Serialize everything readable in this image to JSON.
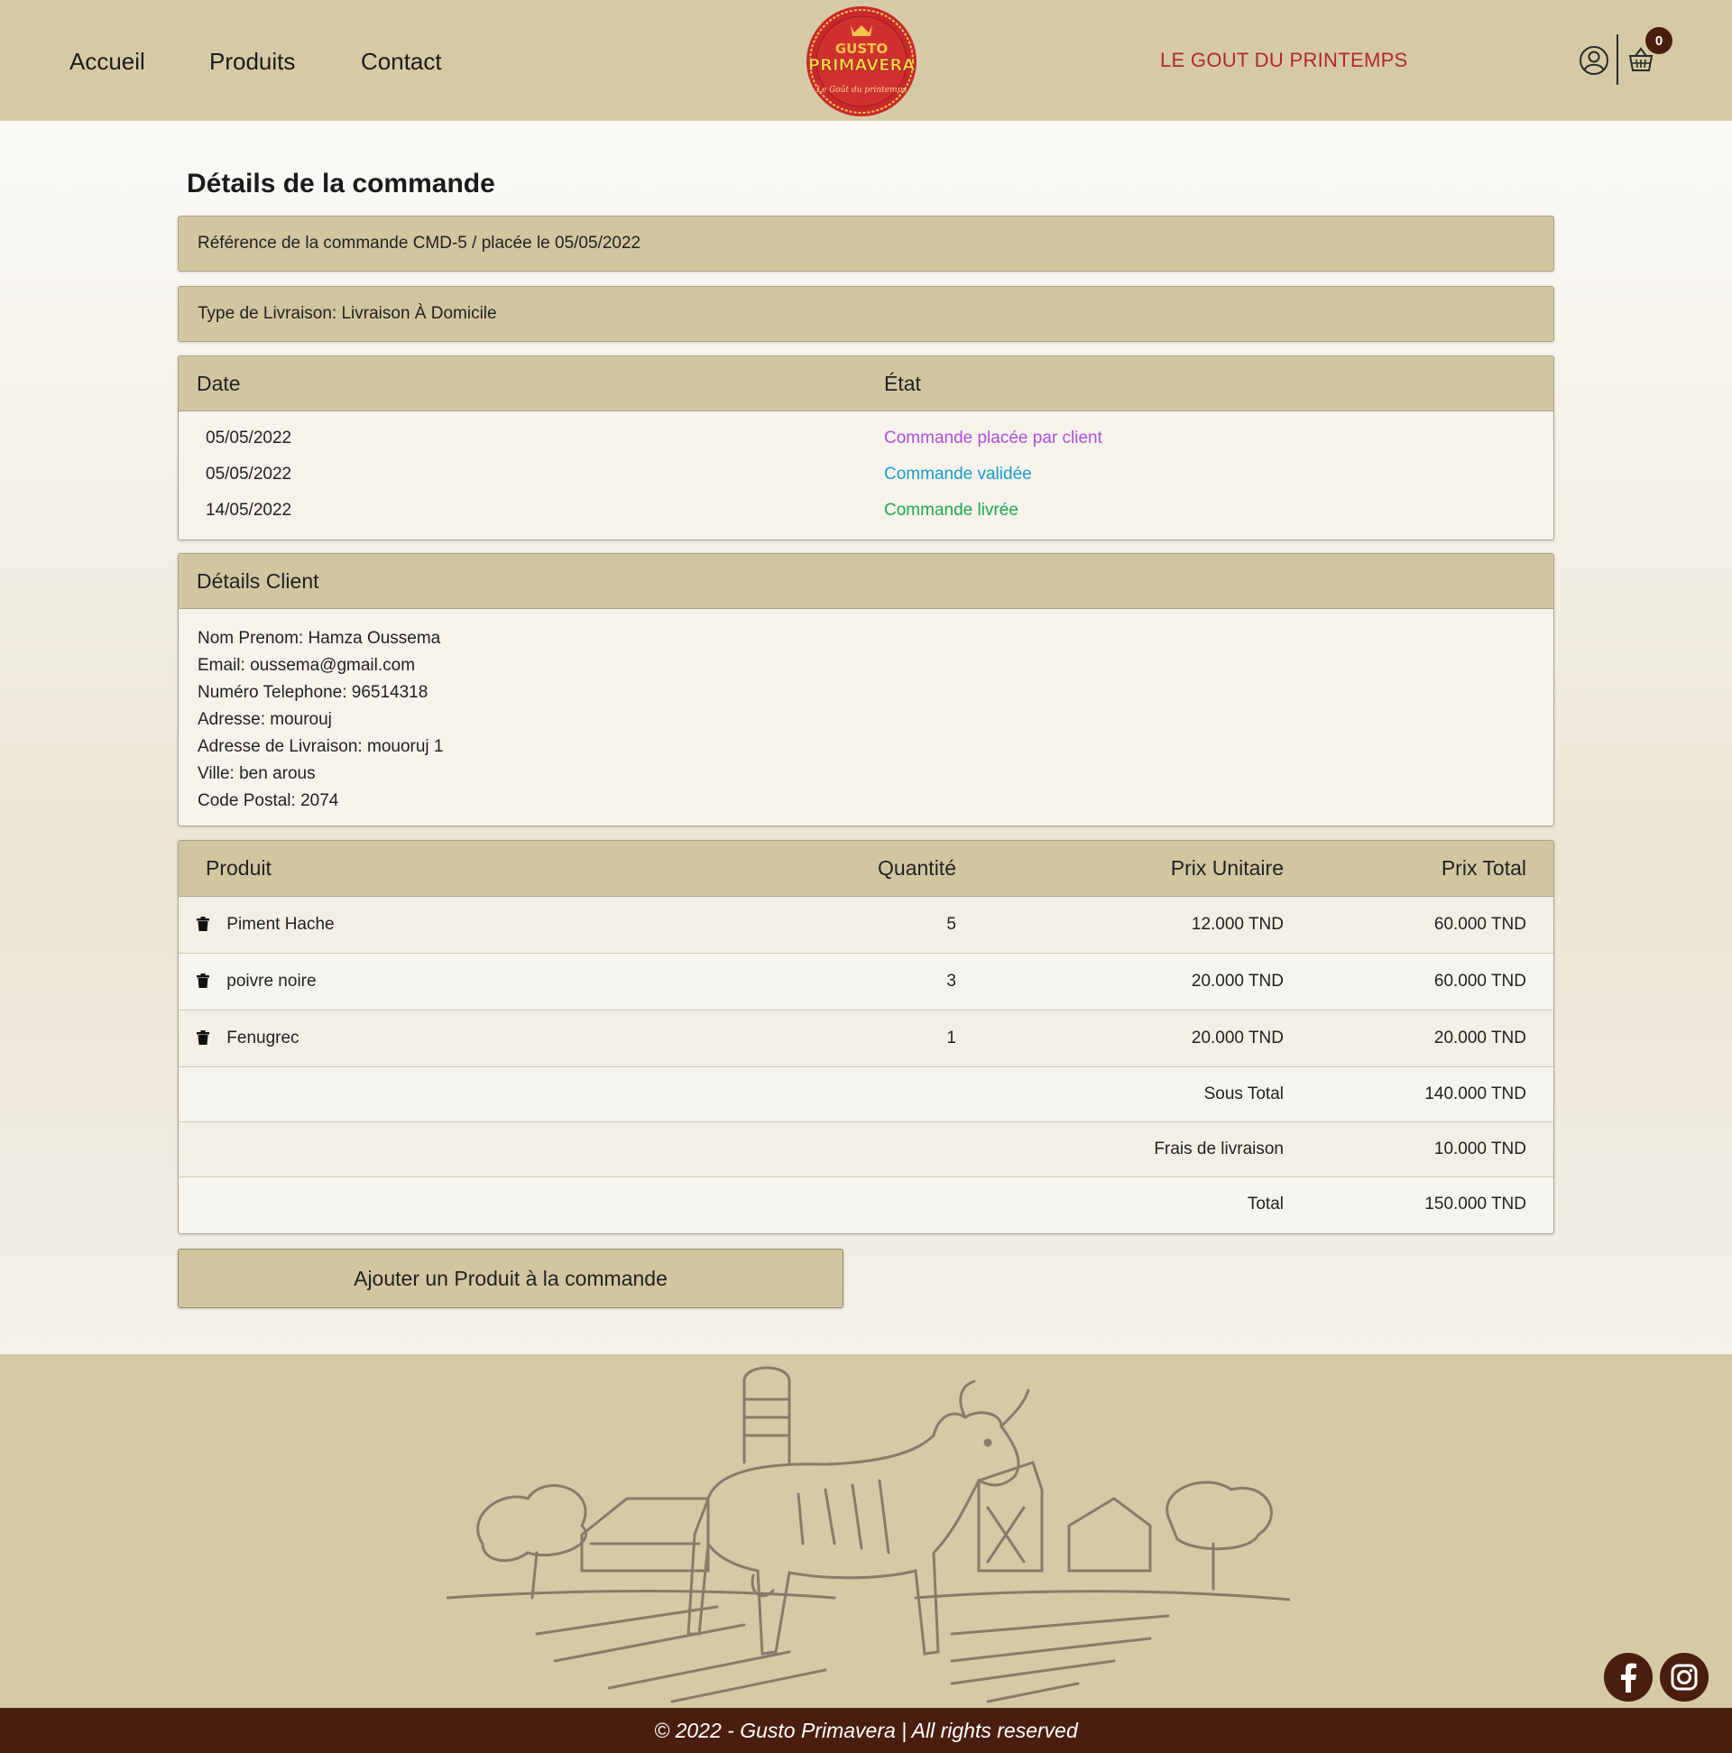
{
  "nav": {
    "items": [
      "Accueil",
      "Produits",
      "Contact"
    ],
    "tagline": "LE GOUT DU PRINTEMPS",
    "logo_text_top": "GUSTO",
    "logo_text_main": "PRIMAVERA",
    "logo_text_ring": "Le Goût du printemps",
    "cart_count": "0"
  },
  "order": {
    "title": "Détails de la commande",
    "reference": "Référence de la commande CMD-5 / placée le 05/05/2022",
    "delivery_type": "Type de Livraison: Livraison À Domicile",
    "status_headers": {
      "date": "Date",
      "state": "État"
    },
    "status_rows": [
      {
        "date": "05/05/2022",
        "state": "Commande placée par client",
        "color": "#b04fe0"
      },
      {
        "date": "05/05/2022",
        "state": "Commande validée",
        "color": "#1a9ec9"
      },
      {
        "date": "14/05/2022",
        "state": "Commande livrée",
        "color": "#22a651"
      }
    ]
  },
  "client": {
    "title": "Détails Client",
    "lines": [
      "Nom Prenom: Hamza Oussema",
      "Email: oussema@gmail.com",
      "Numéro Telephone: 96514318",
      "Adresse: mourouj",
      "Adresse de Livraison: mouoruj 1",
      "Ville: ben arous",
      "Code Postal: 2074"
    ]
  },
  "products": {
    "headers": {
      "product": "Produit",
      "qty": "Quantité",
      "unit": "Prix Unitaire",
      "total": "Prix Total"
    },
    "rows": [
      {
        "name": "Piment Hache",
        "qty": "5",
        "unit": "12.000 TND",
        "total": "60.000 TND"
      },
      {
        "name": "poivre noire",
        "qty": "3",
        "unit": "20.000 TND",
        "total": "60.000 TND"
      },
      {
        "name": "Fenugrec",
        "qty": "1",
        "unit": "20.000 TND",
        "total": "20.000 TND"
      }
    ],
    "subtotal_label": "Sous Total",
    "subtotal": "140.000 TND",
    "shipping_label": "Frais de livraison",
    "shipping": "10.000 TND",
    "total_label": "Total",
    "total": "150.000 TND"
  },
  "actions": {
    "add_product": "Ajouter un Produit à la commande"
  },
  "footer": {
    "copyright": "© 2022 - Gusto Primavera | All rights reserved"
  },
  "colors": {
    "header_bg": "#d6caa6",
    "panel_bg": "#d2c6a1",
    "brand_red": "#b3282d",
    "footer_dark": "#4a1e0e"
  }
}
